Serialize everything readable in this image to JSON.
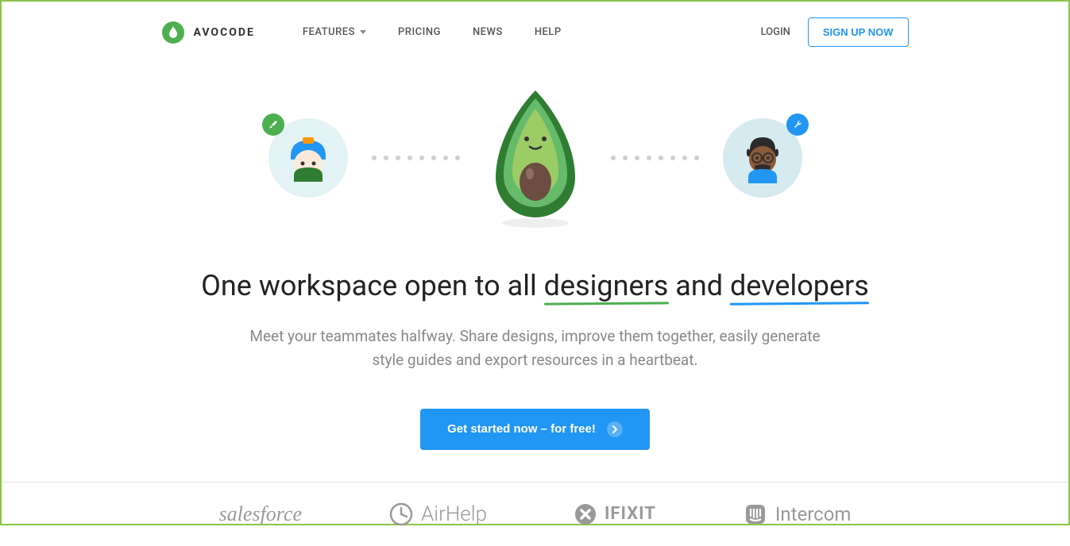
{
  "brand": {
    "name": "AVOCODE"
  },
  "nav": {
    "features": "FEATURES",
    "pricing": "PRICING",
    "news": "NEWS",
    "help": "HELP"
  },
  "auth": {
    "login": "LOGIN",
    "signup": "SIGN UP NOW"
  },
  "hero": {
    "headline_pre": "One workspace open to all ",
    "headline_designers": "designers",
    "headline_and": " and ",
    "headline_developers": "developers",
    "subhead": "Meet your teammates halfway. Share designs, improve them together, easily generate style guides and export resources in a heartbeat.",
    "cta": "Get started now – for free!"
  },
  "logos": {
    "salesforce": "salesforce",
    "airhelp": "AirHelp",
    "ifixit": "IFIXIT",
    "intercom": "Intercom"
  },
  "colors": {
    "green": "#4caf50",
    "blue": "#2196f3",
    "border": "#8bc34a"
  }
}
